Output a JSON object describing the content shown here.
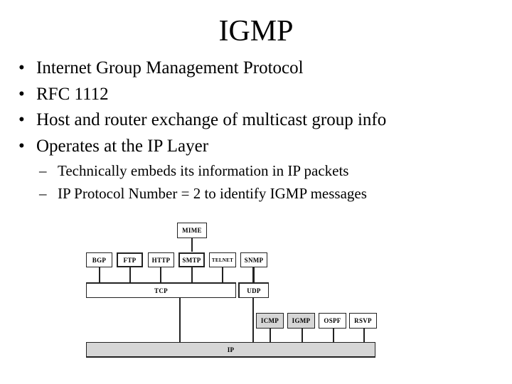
{
  "slide": {
    "title": "IGMP",
    "bullets": [
      "Internet Group Management Protocol",
      "RFC 1112",
      "Host and router exchange of multicast group info",
      "Operates at the IP Layer"
    ],
    "sub_bullets": [
      "Technically embeds its information in IP packets",
      "IP Protocol Number = 2 to identify IGMP messages"
    ],
    "bullet_glyph": "•",
    "sub_bullet_glyph": "–"
  },
  "diagram": {
    "application_layer": [
      "BGP",
      "FTP",
      "HTTP",
      "SMTP",
      "TELNET",
      "SNMP"
    ],
    "mime": "MIME",
    "transport_layer": [
      "TCP",
      "UDP"
    ],
    "ip_layer_protocols": [
      "ICMP",
      "IGMP",
      "OSPF",
      "RSVP"
    ],
    "highlighted": [
      "ICMP",
      "IGMP"
    ],
    "network_layer": "IP",
    "highlight_color": "#d6d6d6"
  }
}
